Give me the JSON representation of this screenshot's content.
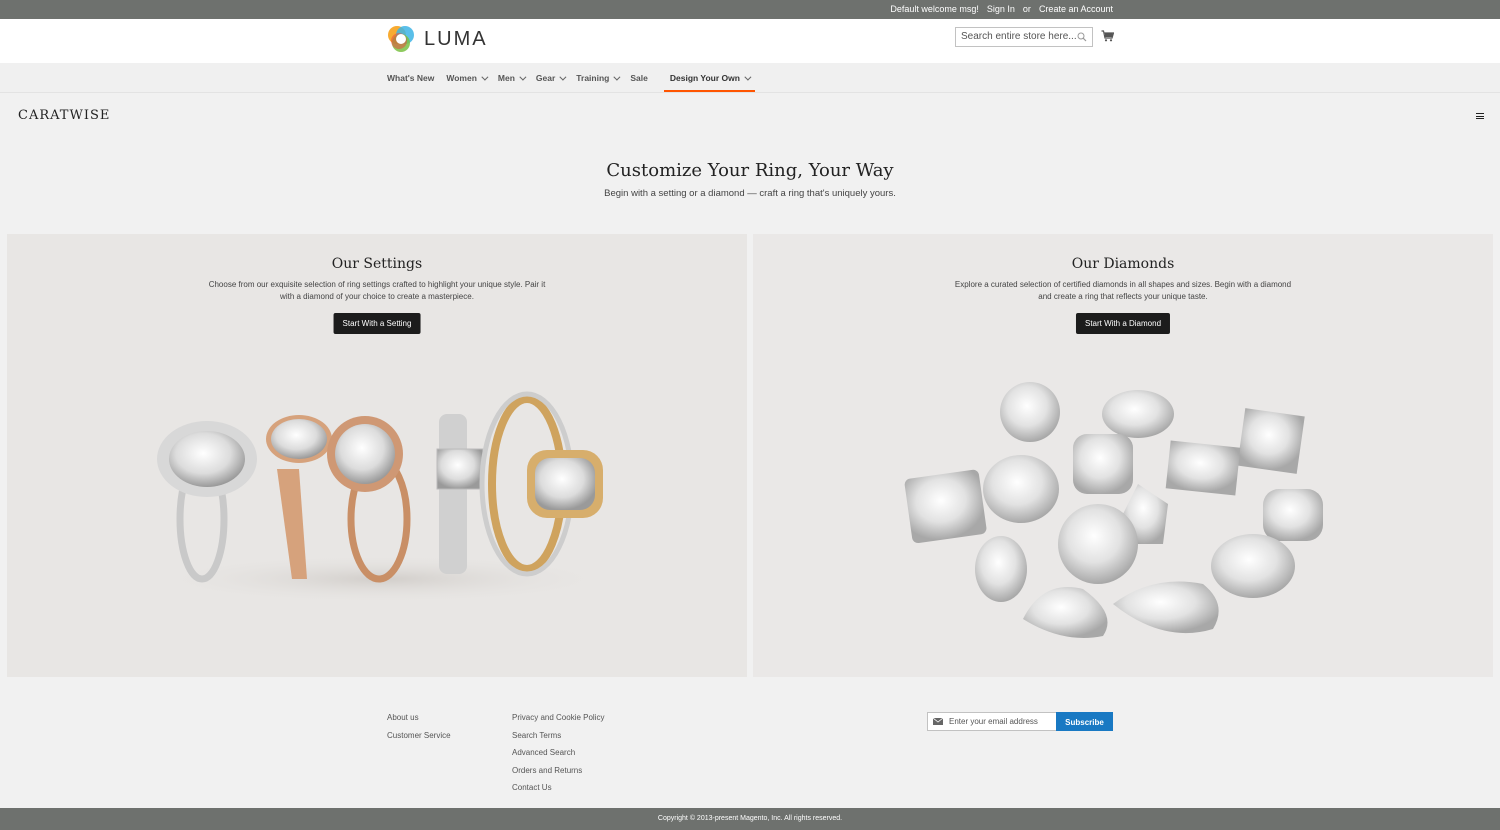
{
  "topbar": {
    "welcome": "Default welcome msg!",
    "sign_in": "Sign In",
    "or": "or",
    "create_account": "Create an Account"
  },
  "header": {
    "logo_text": "LUMA",
    "search_placeholder": "Search entire store here..."
  },
  "nav": {
    "items": [
      {
        "label": "What's New"
      },
      {
        "label": "Women"
      },
      {
        "label": "Men"
      },
      {
        "label": "Gear"
      },
      {
        "label": "Training"
      },
      {
        "label": "Sale"
      },
      {
        "label": "Design Your Own"
      }
    ]
  },
  "brand": {
    "name": "CARATWISE"
  },
  "hero": {
    "title": "Customize Your Ring, Your Way",
    "subtitle": "Begin with a setting or a diamond — craft a ring that's uniquely yours."
  },
  "panels": {
    "settings": {
      "title": "Our Settings",
      "description": "Choose from our exquisite selection of ring settings crafted to highlight your unique style. Pair it with a diamond of your choice to create a masterpiece.",
      "button": "Start With a Setting"
    },
    "diamonds": {
      "title": "Our Diamonds",
      "description": "Explore a curated selection of certified diamonds in all shapes and sizes. Begin with a diamond and create a ring that reflects your unique taste.",
      "button": "Start With a Diamond"
    }
  },
  "footer": {
    "col1": [
      "About us",
      "Customer Service"
    ],
    "col2": [
      "Privacy and Cookie Policy",
      "Search Terms",
      "Advanced Search",
      "Orders and Returns",
      "Contact Us"
    ],
    "newsletter_placeholder": "Enter your email address",
    "subscribe": "Subscribe",
    "copyright": "Copyright © 2013-present Magento, Inc. All rights reserved."
  },
  "colors": {
    "topbar_bg": "#6e716e",
    "accent_orange": "#ff5501",
    "subscribe_blue": "#1979c3",
    "button_dark": "#1c1c1c"
  }
}
